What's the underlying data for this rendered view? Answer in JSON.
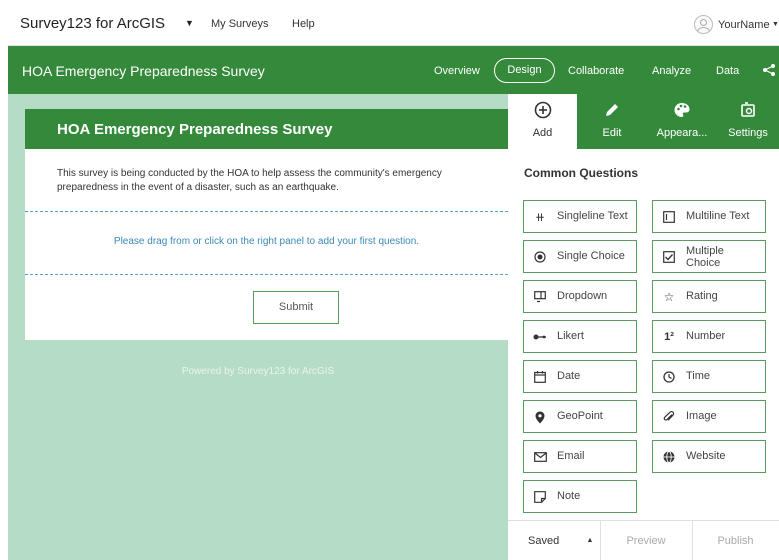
{
  "topbar": {
    "app_title": "Survey123 for ArcGIS",
    "nav": [
      "My Surveys",
      "Help"
    ],
    "username": "YourName"
  },
  "header": {
    "survey_title": "HOA Emergency Preparedness Survey",
    "nav": [
      "Overview",
      "Design",
      "Collaborate",
      "Analyze",
      "Data"
    ],
    "active_nav": "Design"
  },
  "canvas": {
    "card_title": "HOA Emergency Preparedness Survey",
    "description": "This survey is being conducted by the HOA to help assess the community's emergency preparedness in the event of a disaster, such as an earthquake.",
    "dropzone_text": "Please drag from or click on the right panel to add your first question.",
    "submit_label": "Submit",
    "powered_by": "Powered by Survey123 for ArcGIS"
  },
  "panel": {
    "tabs": [
      {
        "label": "Add",
        "icon": "plus-circle-icon"
      },
      {
        "label": "Edit",
        "icon": "pencil-icon"
      },
      {
        "label": "Appeara...",
        "icon": "palette-icon"
      },
      {
        "label": "Settings",
        "icon": "settings-icon"
      }
    ],
    "section_title": "Common Questions",
    "questions": [
      {
        "label": "Singleline Text",
        "icon": "singleline-text-icon"
      },
      {
        "label": "Multiline Text",
        "icon": "multiline-text-icon"
      },
      {
        "label": "Single Choice",
        "icon": "radio-icon"
      },
      {
        "label": "Multiple Choice",
        "icon": "checkbox-icon"
      },
      {
        "label": "Dropdown",
        "icon": "dropdown-icon"
      },
      {
        "label": "Rating",
        "icon": "star-icon"
      },
      {
        "label": "Likert",
        "icon": "likert-icon"
      },
      {
        "label": "Number",
        "icon": "number-icon"
      },
      {
        "label": "Date",
        "icon": "calendar-icon"
      },
      {
        "label": "Time",
        "icon": "clock-icon"
      },
      {
        "label": "GeoPoint",
        "icon": "map-pin-icon"
      },
      {
        "label": "Image",
        "icon": "paperclip-icon"
      },
      {
        "label": "Email",
        "icon": "envelope-icon"
      },
      {
        "label": "Website",
        "icon": "globe-icon"
      },
      {
        "label": "Note",
        "icon": "note-icon"
      }
    ],
    "footer": {
      "saved_label": "Saved",
      "preview_label": "Preview",
      "publish_label": "Publish"
    }
  },
  "colors": {
    "brand_green": "#35893b",
    "canvas_bg": "#b5dcc4",
    "link_blue": "#3c88b7"
  }
}
